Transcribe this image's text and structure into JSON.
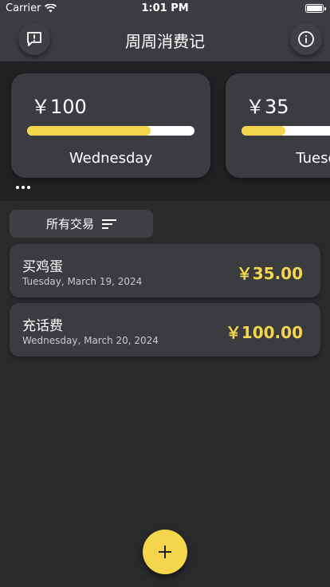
{
  "status_bar": {
    "carrier": "Carrier",
    "time": "1:01 PM"
  },
  "header": {
    "title": "周周消费记",
    "left_icon": "feedback-icon",
    "right_icon": "info-icon"
  },
  "day_cards": [
    {
      "amount": "￥100",
      "day": "Wednesday",
      "progress": 0.74
    },
    {
      "amount": "￥35",
      "day": "Tuesday",
      "progress": 0.26
    }
  ],
  "filter": {
    "label": "所有交易",
    "icon": "sort-lines-icon"
  },
  "transactions": [
    {
      "name": "买鸡蛋",
      "date": "Tuesday, March 19, 2024",
      "amount": "￥35.00"
    },
    {
      "name": "充话费",
      "date": "Wednesday, March 20, 2024",
      "amount": "￥100.00"
    }
  ],
  "fab": {
    "label": "+",
    "icon": "plus-icon"
  },
  "colors": {
    "accent": "#f4d54c",
    "card": "#3a3c40",
    "background": "#292a2c"
  }
}
